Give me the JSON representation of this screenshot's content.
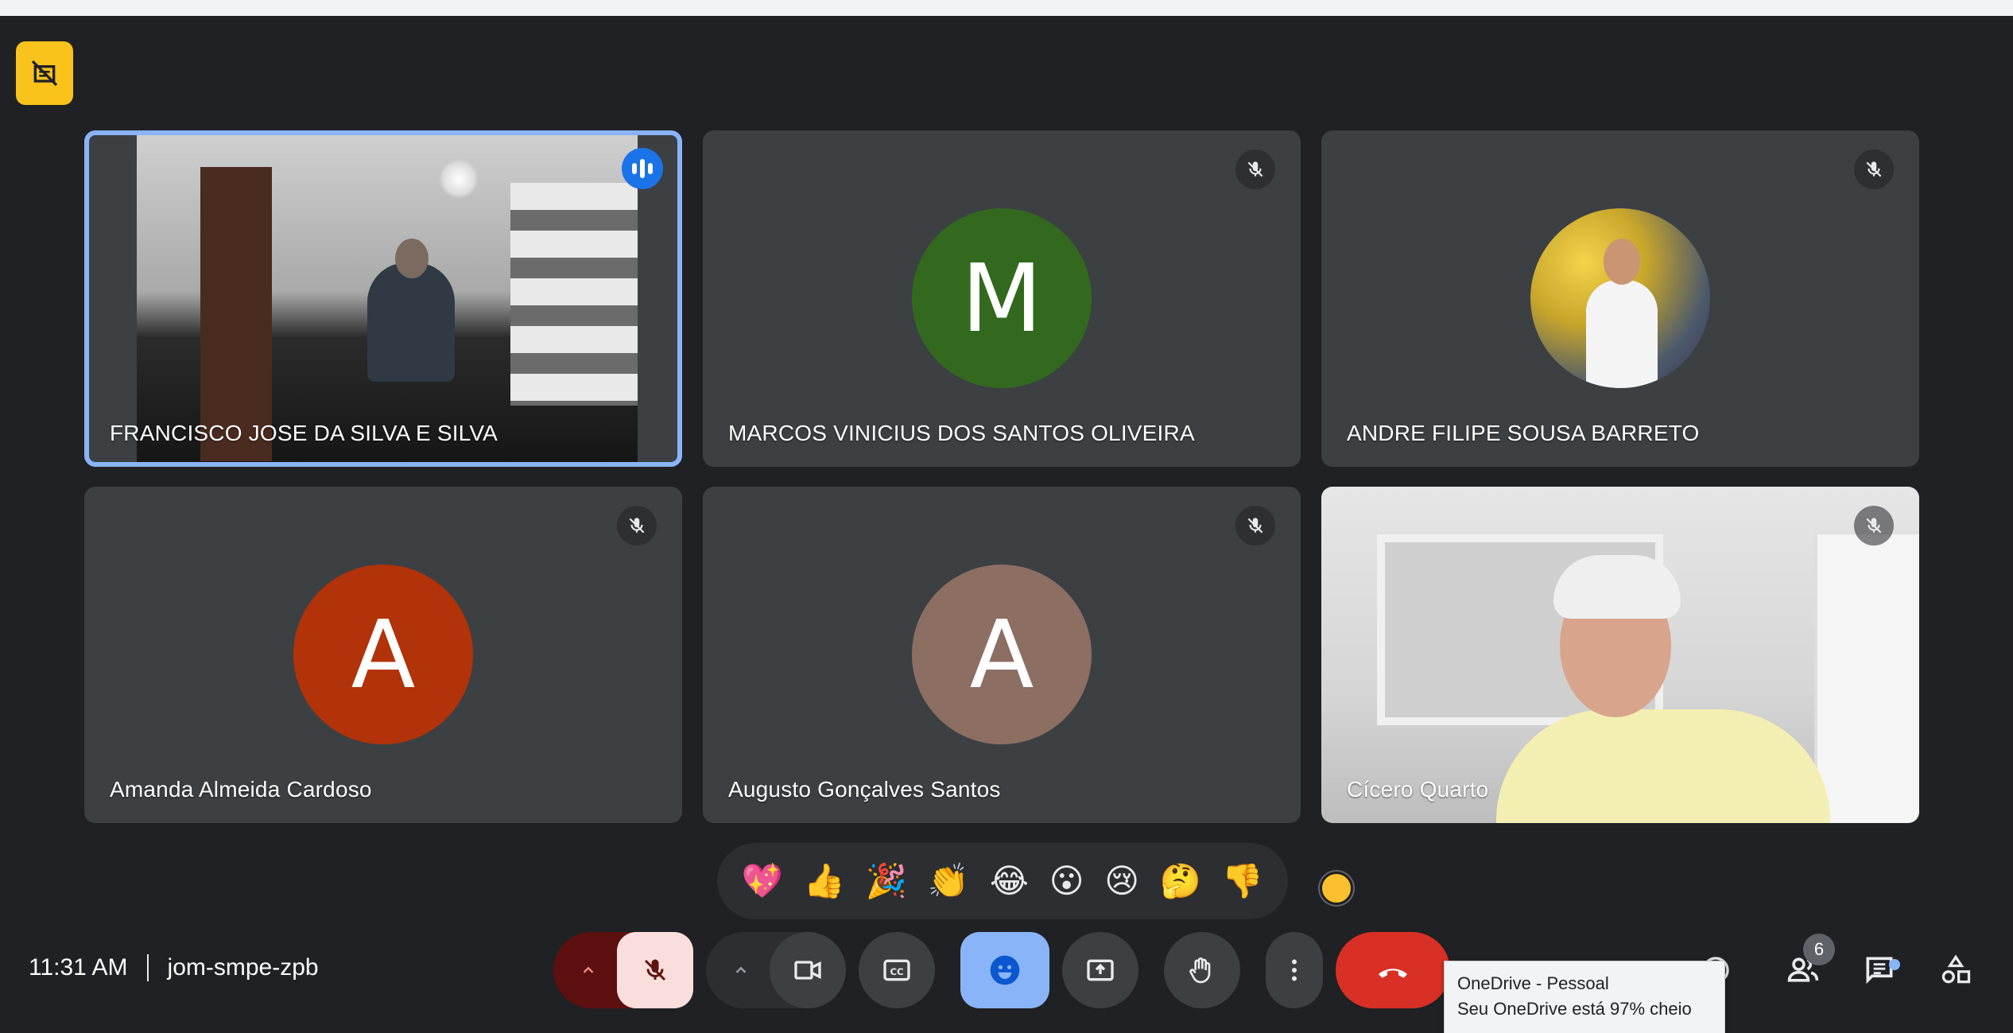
{
  "meeting": {
    "time": "11:31 AM",
    "code": "jom-smpe-zpb"
  },
  "participants": [
    {
      "name": "FRANCISCO JOSE DA SILVA E SILVA",
      "state": "speaking",
      "media": "video"
    },
    {
      "name": "MARCOS VINICIUS DOS SANTOS OLIVEIRA",
      "state": "muted",
      "avatar_letter": "M",
      "avatar_color": "#33691e"
    },
    {
      "name": "ANDRE FILIPE SOUSA BARRETO",
      "state": "muted",
      "media": "profile-photo"
    },
    {
      "name": "Amanda Almeida Cardoso",
      "state": "muted",
      "avatar_letter": "A",
      "avatar_color": "#b23209"
    },
    {
      "name": "Augusto Gonçalves Santos",
      "state": "muted",
      "avatar_letter": "A",
      "avatar_color": "#8d6e63"
    },
    {
      "name": "Cícero Quarto",
      "state": "muted",
      "media": "video"
    }
  ],
  "reactions": [
    "💖",
    "👍",
    "🎉",
    "👏",
    "😂",
    "😮",
    "😢",
    "🤔",
    "👎"
  ],
  "skin_tone_color": "#fbc02d",
  "participant_count": "6",
  "tooltip": {
    "title": "OneDrive - Pessoal",
    "message": "Seu OneDrive está 97% cheio"
  },
  "icons": {
    "top_badge": "hide-self-view-icon",
    "mic": "mic-off-icon",
    "camera": "videocam-icon",
    "captions": "closed-caption-icon",
    "emoji": "emoji-icon",
    "present": "present-screen-icon",
    "raise_hand": "hand-icon",
    "more": "more-vert-icon",
    "leave": "call-end-icon",
    "info": "info-icon",
    "people": "people-icon",
    "chat": "chat-icon",
    "activities": "activities-icon"
  },
  "colors": {
    "background": "#202124",
    "tile": "#3c4043",
    "speaking_border": "#8ab4f8",
    "leave": "#d93025",
    "mic_off_bg": "#f9dedc"
  }
}
